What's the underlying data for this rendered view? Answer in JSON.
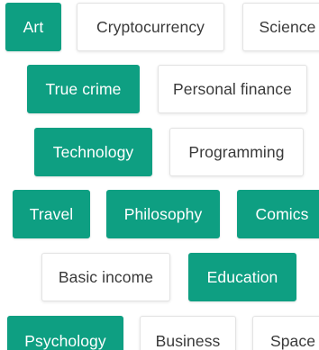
{
  "topics": [
    {
      "label": "Art",
      "selected": true
    },
    {
      "label": "Cryptocurrency",
      "selected": false
    },
    {
      "label": "Science",
      "selected": false
    },
    {
      "label": "True crime",
      "selected": true
    },
    {
      "label": "Personal finance",
      "selected": false
    },
    {
      "label": "Technology",
      "selected": true
    },
    {
      "label": "Programming",
      "selected": false
    },
    {
      "label": "Travel",
      "selected": true
    },
    {
      "label": "Philosophy",
      "selected": true
    },
    {
      "label": "Comics",
      "selected": true
    },
    {
      "label": "Basic income",
      "selected": false
    },
    {
      "label": "Education",
      "selected": true
    },
    {
      "label": "Psychology",
      "selected": true
    },
    {
      "label": "Business",
      "selected": false
    },
    {
      "label": "Space",
      "selected": false
    }
  ],
  "colors": {
    "selected_bg": "#0e9f82",
    "selected_text": "#ffffff",
    "unselected_bg": "#ffffff",
    "unselected_text": "#3a3a3a",
    "unselected_border": "#e3e3e3"
  }
}
